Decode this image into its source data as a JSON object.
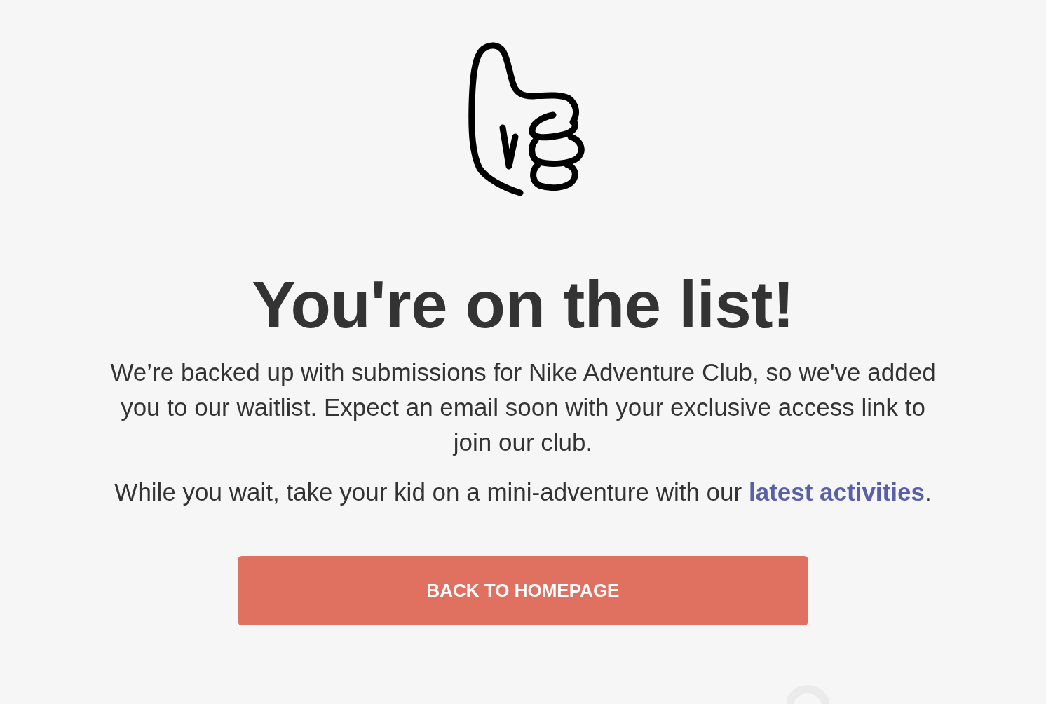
{
  "heading": "You're on the list!",
  "message": "We’re backed up with submissions for Nike Adventure Club, so we've added you to our waitlist. Expect an email soon with your exclusive access link to join our club.",
  "note": {
    "text": "While you wait, take your kid on a mini-adventure with our ",
    "link": "latest activities",
    "after": "."
  },
  "button": {
    "label": "BACK TO HOMEPAGE"
  }
}
